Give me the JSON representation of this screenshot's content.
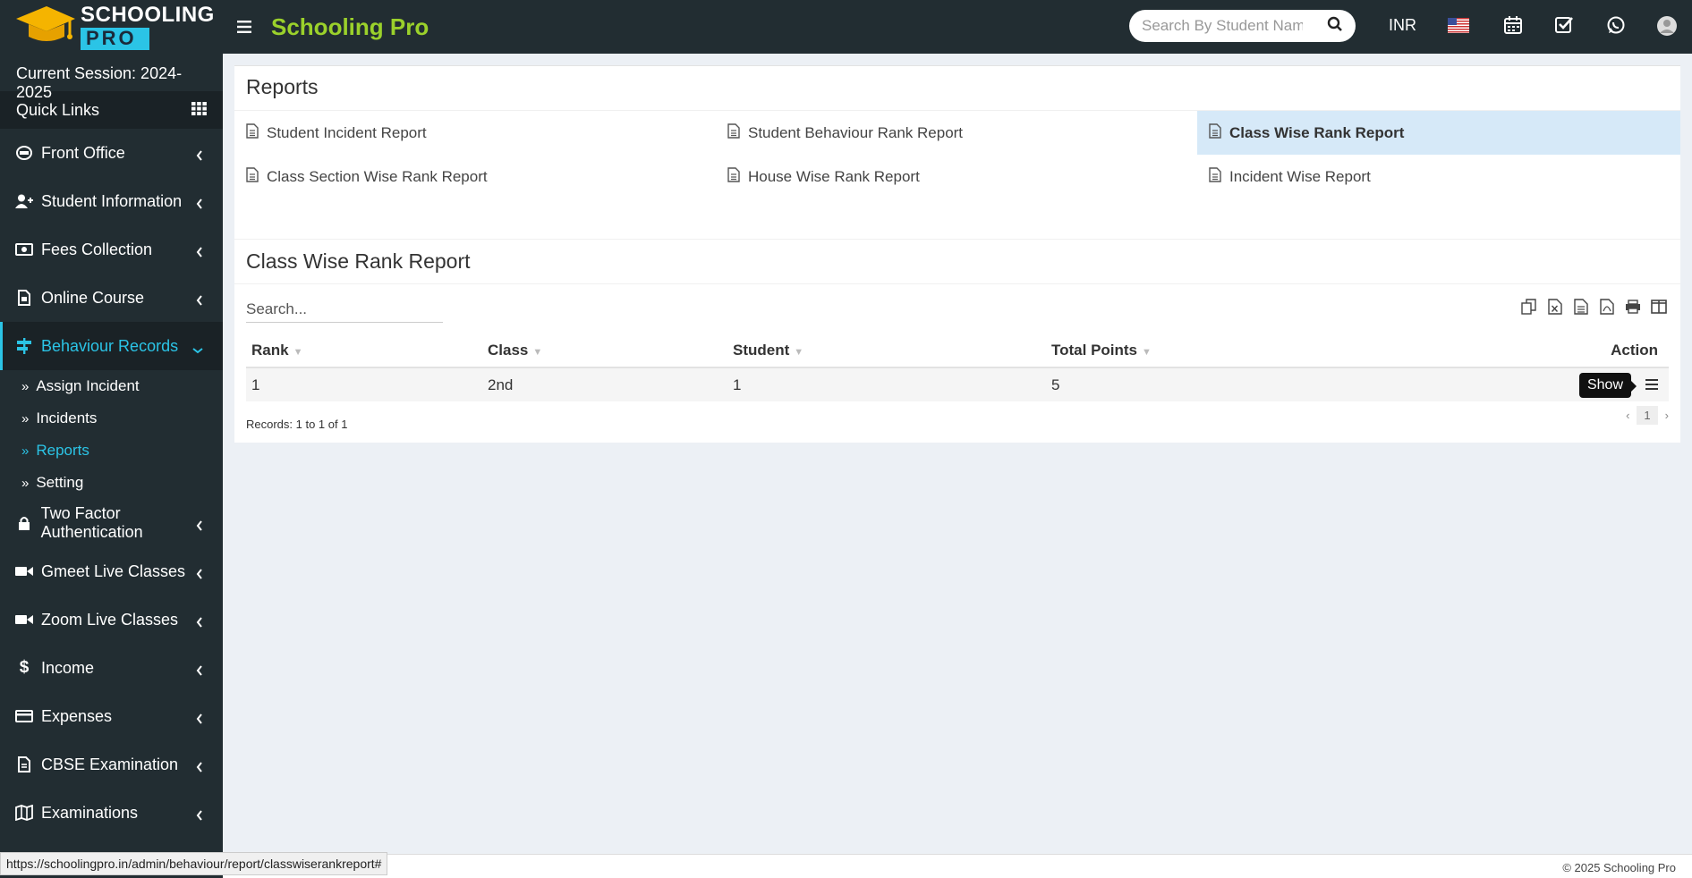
{
  "header": {
    "logo_line1": "SCHOOLING",
    "logo_line2": "PRO",
    "brand": "Schooling Pro",
    "search_placeholder": "Search By Student Name",
    "currency": "INR",
    "icons": [
      "menu-icon",
      "search-icon",
      "us-flag-icon",
      "calendar-icon",
      "task-check-icon",
      "whatsapp-icon",
      "user-avatar-icon"
    ],
    "brand_color": "#9bd12b",
    "accent_color": "#2bc4e6"
  },
  "sidebar": {
    "session": "Current Session: 2024-2025",
    "quick_links": "Quick Links",
    "items": [
      {
        "label": "Front Office",
        "icon": "front-office-icon"
      },
      {
        "label": "Student Information",
        "icon": "user-plus-icon"
      },
      {
        "label": "Fees Collection",
        "icon": "money-icon"
      },
      {
        "label": "Online Course",
        "icon": "course-file-icon"
      },
      {
        "label": "Behaviour Records",
        "icon": "sign-post-icon"
      },
      {
        "label": "Two Factor Authentication",
        "icon": "lock-icon"
      },
      {
        "label": "Gmeet Live Classes",
        "icon": "video-icon"
      },
      {
        "label": "Zoom Live Classes",
        "icon": "video-icon"
      },
      {
        "label": "Income",
        "icon": "dollar-icon"
      },
      {
        "label": "Expenses",
        "icon": "credit-card-icon"
      },
      {
        "label": "CBSE Examination",
        "icon": "document-icon"
      },
      {
        "label": "Examinations",
        "icon": "map-icon"
      }
    ],
    "submenu": [
      {
        "label": "Assign Incident"
      },
      {
        "label": "Incidents"
      },
      {
        "label": "Reports"
      },
      {
        "label": "Setting"
      }
    ]
  },
  "reports": {
    "title": "Reports",
    "links": [
      "Student Incident Report",
      "Student Behaviour Rank Report",
      "Class Wise Rank Report",
      "Class Section Wise Rank Report",
      "House Wise Rank Report",
      "Incident Wise Report"
    ]
  },
  "rank_report": {
    "title": "Class Wise Rank Report",
    "search_placeholder": "Search...",
    "tools": [
      "copy-icon",
      "excel-icon",
      "csv-icon",
      "pdf-icon",
      "print-icon",
      "columns-icon"
    ],
    "columns": [
      "Rank",
      "Class",
      "Student",
      "Total Points",
      "Action"
    ],
    "rows": [
      {
        "rank": "1",
        "class": "2nd",
        "student": "1",
        "total": "5"
      }
    ],
    "action_tooltip": "Show",
    "records": "Records: 1 to 1 of 1",
    "page": "1",
    "prev": "‹",
    "next": "›"
  },
  "footer": {
    "copyright": "© 2025 Schooling Pro",
    "status_url": "https://schoolingpro.in/admin/behaviour/report/classwiserankreport#"
  }
}
